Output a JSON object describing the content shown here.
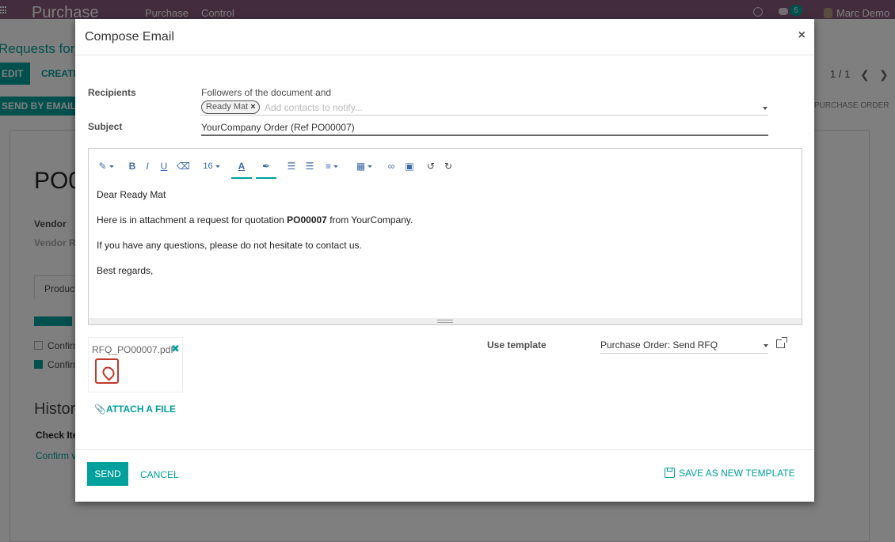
{
  "app": {
    "brand": "Purchase",
    "menu": [
      "Purchase",
      "Control"
    ],
    "chat_count": "5",
    "user_name": "Marc Demo"
  },
  "background": {
    "breadcrumb": "Requests for Q",
    "edit_label": "EDIT",
    "create_label": "CREATE",
    "pager": "1 / 1",
    "send_email_label": "SEND BY EMAIL",
    "status_label": "PURCHASE ORDER",
    "po_name": "PO0",
    "vendor_label": "Vendor",
    "vendor_ref_label": "Vendor Re",
    "products_tab": "Product",
    "confirm_1": "Confirm",
    "confirm_2": "Confirm",
    "history_title": "Histor",
    "check_item": "Check Ite",
    "confirm_link": "Confirm v"
  },
  "dialog": {
    "title": "Compose Email",
    "recipients_label": "Recipients",
    "followers_text": "Followers of the document and",
    "recipient_tag": "Ready Mat",
    "recipients_placeholder": "Add contacts to notify...",
    "subject_label": "Subject",
    "subject_value": "YourCompany Order (Ref PO00007)",
    "toolbar": {
      "font_size": "16"
    },
    "body": {
      "greeting": "Dear Ready Mat",
      "line2_pre": "Here is in attachment a request for quotation ",
      "line2_bold": "PO00007",
      "line2_post": " from YourCompany.",
      "line3": "If you have any questions, please do not hesitate to contact us.",
      "closing": "Best regards,"
    },
    "attachment_name": "RFQ_PO00007.pdf",
    "attach_label": "ATTACH A FILE",
    "template_label": "Use template",
    "template_value": "Purchase Order: Send RFQ",
    "send_label": "SEND",
    "cancel_label": "CANCEL",
    "save_template_label": "SAVE AS NEW TEMPLATE"
  },
  "colors": {
    "topbar": "#875a7b",
    "accent": "#00a09d",
    "toolbar_icon": "#3d6ba6"
  }
}
